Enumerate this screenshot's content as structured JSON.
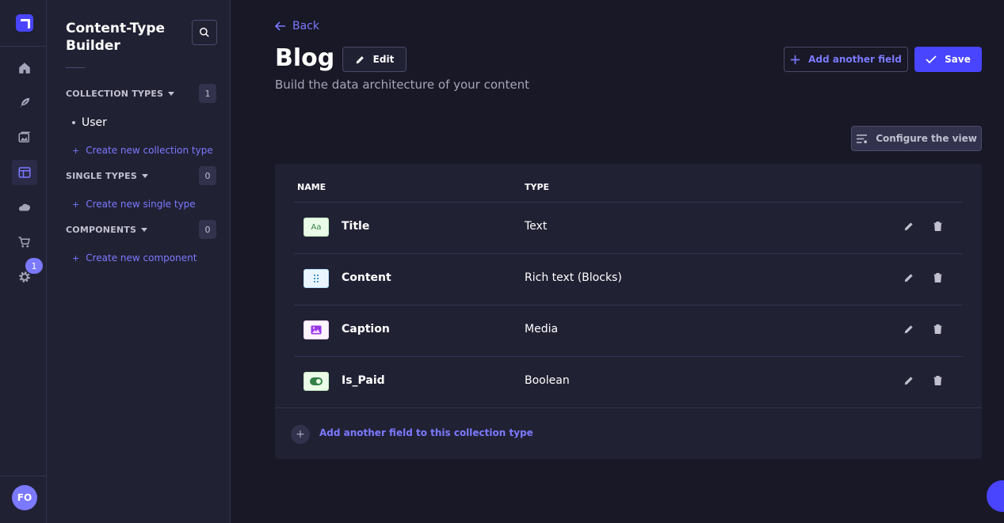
{
  "nav": {
    "notification_count": "1",
    "avatar_initials": "FO"
  },
  "subnav": {
    "title": "Content-Type Builder",
    "sections": [
      {
        "label": "COLLECTION TYPES",
        "count": "1",
        "items": [
          "User"
        ],
        "create_label": "Create new collection type"
      },
      {
        "label": "SINGLE TYPES",
        "count": "0",
        "items": [],
        "create_label": "Create new single type"
      },
      {
        "label": "COMPONENTS",
        "count": "0",
        "items": [],
        "create_label": "Create new component"
      }
    ]
  },
  "header": {
    "back_label": "Back",
    "title": "Blog",
    "edit_label": "Edit",
    "subtitle": "Build the data architecture of your content",
    "add_field_label": "Add another field",
    "save_label": "Save",
    "configure_label": "Configure the view"
  },
  "table": {
    "columns": [
      "NAME",
      "TYPE"
    ],
    "rows": [
      {
        "name": "Title",
        "type": "Text",
        "icon": "text-type-icon"
      },
      {
        "name": "Content",
        "type": "Rich text (Blocks)",
        "icon": "blocks-type-icon"
      },
      {
        "name": "Caption",
        "type": "Media",
        "icon": "media-type-icon"
      },
      {
        "name": "Is_Paid",
        "type": "Boolean",
        "icon": "boolean-type-icon"
      }
    ],
    "footer_label": "Add another field to this collection type"
  },
  "colors": {
    "primary": "#4945ff",
    "accent": "#7b79ff",
    "background": "#181826",
    "panel": "#212134"
  }
}
